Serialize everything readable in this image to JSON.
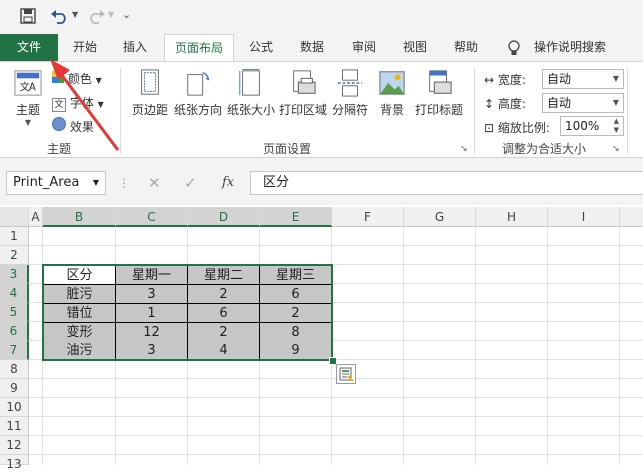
{
  "quick_access": {
    "save_icon": "save-icon",
    "undo_icon": "undo-icon",
    "redo_icon": "redo-icon",
    "customize_icon": "customize-icon"
  },
  "tabs": [
    {
      "label": "文件",
      "state": "file"
    },
    {
      "label": "开始",
      "state": ""
    },
    {
      "label": "插入",
      "state": ""
    },
    {
      "label": "页面布局",
      "state": "active"
    },
    {
      "label": "公式",
      "state": ""
    },
    {
      "label": "数据",
      "state": ""
    },
    {
      "label": "审阅",
      "state": ""
    },
    {
      "label": "视图",
      "state": ""
    },
    {
      "label": "帮助",
      "state": ""
    }
  ],
  "tell_me": "操作说明搜索",
  "ribbon": {
    "theme_group": {
      "theme": "主题",
      "colors": "颜色",
      "fonts": "字体",
      "effects": "效果",
      "label": "主题"
    },
    "page_setup": {
      "buttons": [
        "页边距",
        "纸张方向",
        "纸张大小",
        "打印区域",
        "分隔符",
        "背景",
        "打印标题"
      ],
      "label": "页面设置"
    },
    "scale_fit": {
      "width_label": "宽度:",
      "width_value": "自动",
      "height_label": "高度:",
      "height_value": "自动",
      "scale_label": "缩放比例:",
      "scale_value": "100%",
      "label": "调整为合适大小"
    }
  },
  "formula_bar": {
    "name_box": "Print_Area",
    "fx": "fx",
    "content": "区分"
  },
  "columns": [
    "A",
    "B",
    "C",
    "D",
    "E",
    "F",
    "G",
    "H",
    "I"
  ],
  "rows": [
    "1",
    "2",
    "3",
    "4",
    "5",
    "6",
    "7",
    "8",
    "9",
    "10",
    "11",
    "12",
    "13"
  ],
  "table": {
    "header": [
      "区分",
      "星期一",
      "星期二",
      "星期三"
    ],
    "rows": [
      [
        "脏污",
        "3",
        "2",
        "6"
      ],
      [
        "错位",
        "1",
        "6",
        "2"
      ],
      [
        "变形",
        "12",
        "2",
        "8"
      ],
      [
        "油污",
        "3",
        "4",
        "9"
      ]
    ]
  },
  "colors": {
    "accent": "#217346",
    "arrow": "#e53935",
    "shade": "#c6c6c6"
  }
}
